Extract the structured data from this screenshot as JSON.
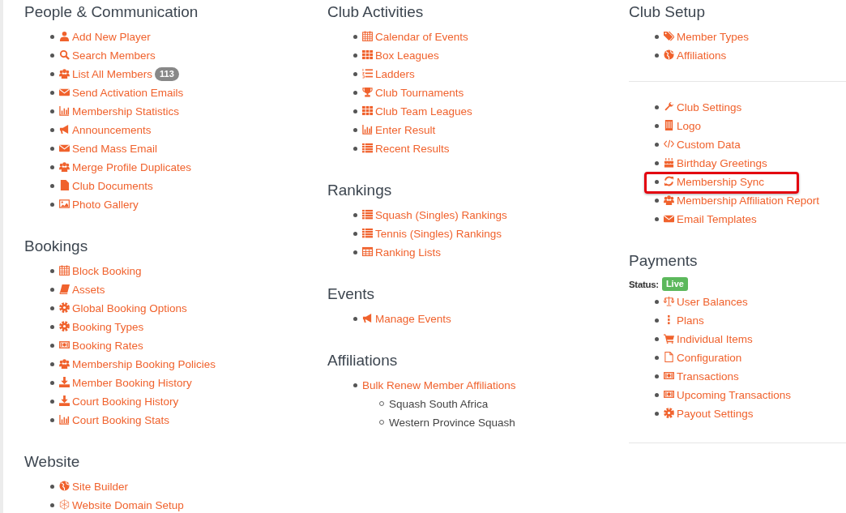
{
  "columns": [
    {
      "blocks": [
        {
          "kind": "section",
          "title": "People & Communication",
          "items": [
            {
              "label": "Add New Player"
            },
            {
              "label": "Search Members"
            },
            {
              "label": "List All Members",
              "badge": "113"
            },
            {
              "label": "Send Activation Emails"
            },
            {
              "label": "Membership Statistics"
            },
            {
              "label": "Announcements"
            },
            {
              "label": "Send Mass Email"
            },
            {
              "label": "Merge Profile Duplicates"
            },
            {
              "label": "Club Documents"
            },
            {
              "label": "Photo Gallery"
            }
          ]
        },
        {
          "kind": "section",
          "title": "Bookings",
          "items": [
            {
              "label": "Block Booking"
            },
            {
              "label": "Assets"
            },
            {
              "label": "Global Booking Options"
            },
            {
              "label": "Booking Types"
            },
            {
              "label": "Booking Rates"
            },
            {
              "label": "Membership Booking Policies"
            },
            {
              "label": "Member Booking History"
            },
            {
              "label": "Court Booking History"
            },
            {
              "label": "Court Booking Stats"
            }
          ]
        },
        {
          "kind": "section",
          "title": "Website",
          "items": [
            {
              "label": "Site Builder"
            },
            {
              "label": "Website Domain Setup"
            }
          ]
        }
      ]
    },
    {
      "blocks": [
        {
          "kind": "section",
          "title": "Club Activities",
          "items": [
            {
              "label": "Calendar of Events"
            },
            {
              "label": "Box Leagues"
            },
            {
              "label": "Ladders"
            },
            {
              "label": "Club Tournaments"
            },
            {
              "label": "Club Team Leagues"
            },
            {
              "label": "Enter Result"
            },
            {
              "label": "Recent Results"
            }
          ]
        },
        {
          "kind": "section",
          "title": "Rankings",
          "items": [
            {
              "label": "Squash (Singles) Rankings"
            },
            {
              "label": "Tennis (Singles) Rankings"
            },
            {
              "label": "Ranking Lists"
            }
          ]
        },
        {
          "kind": "section",
          "title": "Events",
          "items": [
            {
              "label": "Manage Events"
            }
          ]
        },
        {
          "kind": "section",
          "title": "Affiliations",
          "items": [
            {
              "label": "Bulk Renew Member Affiliations",
              "children": [
                {
                  "label": "Squash South Africa"
                },
                {
                  "label": "Western Province Squash"
                }
              ]
            }
          ]
        }
      ]
    },
    {
      "blocks": [
        {
          "kind": "section",
          "title": "Club Setup",
          "items": [
            {
              "label": "Member Types"
            },
            {
              "label": "Affiliations"
            }
          ]
        },
        {
          "kind": "divider"
        },
        {
          "kind": "section",
          "items": [
            {
              "label": "Club Settings",
              "highlighted": false
            },
            {
              "label": "Logo",
              "highlighted": false
            },
            {
              "label": "Custom Data",
              "highlighted": false
            },
            {
              "label": "Birthday Greetings",
              "highlighted": false
            },
            {
              "label": "Membership Sync",
              "highlighted": true
            },
            {
              "label": "Membership Affiliation Report",
              "highlighted": false
            },
            {
              "label": "Email Templates",
              "highlighted": false
            }
          ]
        },
        {
          "kind": "section",
          "title": "Payments",
          "status": {
            "label": "Status:",
            "value": "Live"
          },
          "items": [
            {
              "label": "User Balances"
            },
            {
              "label": "Plans"
            },
            {
              "label": "Individual Items"
            },
            {
              "label": "Configuration"
            },
            {
              "label": "Transactions"
            },
            {
              "label": "Upcoming Transactions"
            },
            {
              "label": "Payout Settings"
            }
          ]
        },
        {
          "kind": "divider"
        }
      ]
    }
  ]
}
